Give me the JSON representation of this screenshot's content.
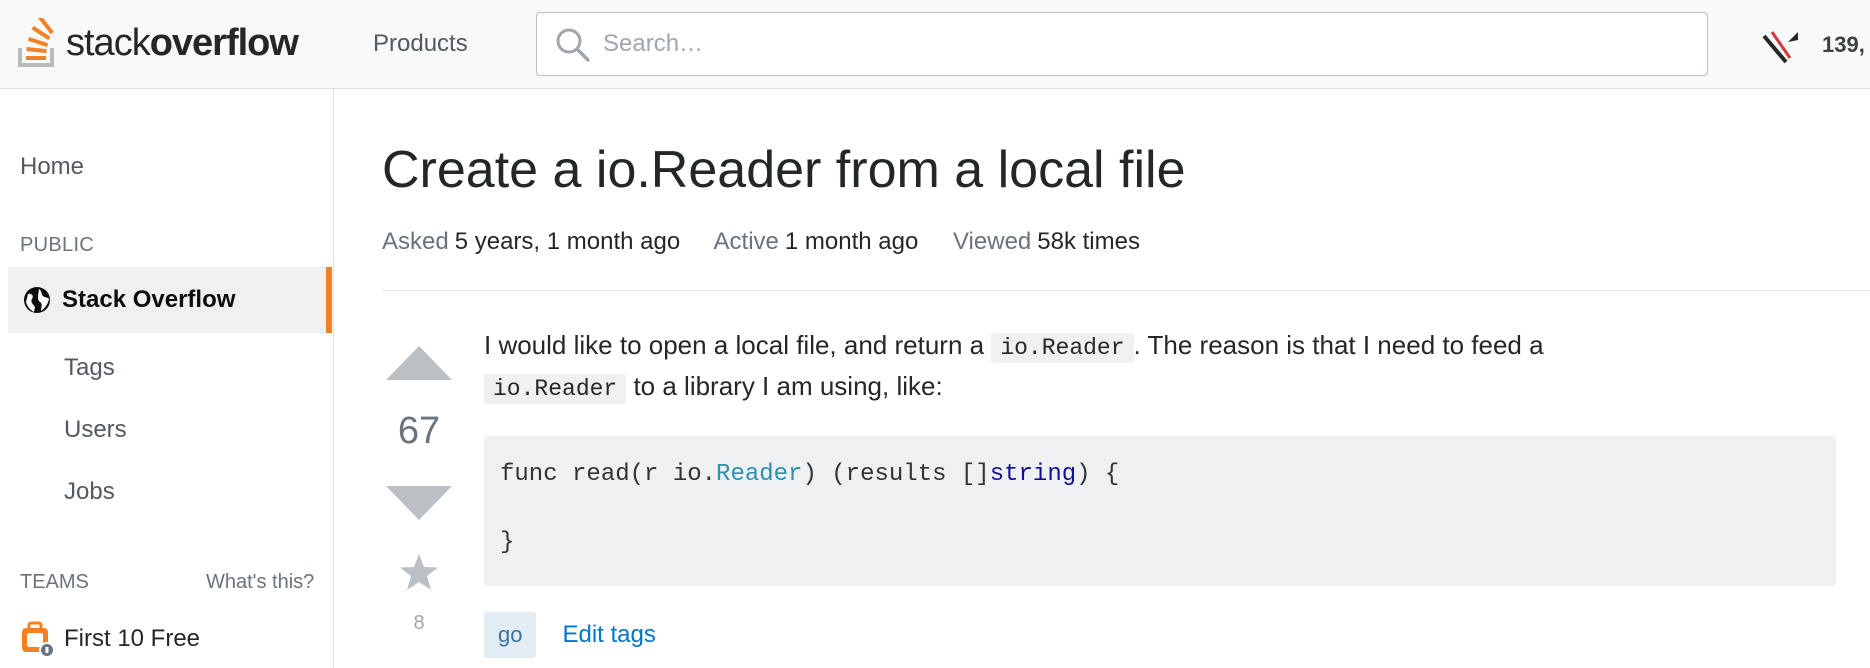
{
  "header": {
    "logo": {
      "brand_light": "stack",
      "brand_bold": "overflow"
    },
    "products_label": "Products",
    "search": {
      "placeholder": "Search…",
      "value": ""
    },
    "reputation": "139,"
  },
  "sidebar": {
    "home": "Home",
    "public_heading": "PUBLIC",
    "stack_overflow": "Stack Overflow",
    "items": [
      "Tags",
      "Users",
      "Jobs"
    ],
    "teams_heading": "TEAMS",
    "whats_this": "What's this?",
    "first_free": "First 10 Free"
  },
  "question": {
    "title": "Create a io.Reader from a local file",
    "meta": {
      "asked_label": "Asked",
      "asked_value": "5 years, 1 month ago",
      "active_label": "Active",
      "active_value": "1 month ago",
      "viewed_label": "Viewed",
      "viewed_value": "58k times"
    },
    "votes": "67",
    "favorites": "8",
    "body": {
      "text_1": "I would like to open a local file, and return a ",
      "code_1": "io.Reader",
      "text_2": ". The reason is that I need to feed a",
      "code_2": "io.Reader",
      "text_3": " to a library I am using, like:"
    },
    "code_block": {
      "line1_a": "func read(r io.",
      "line1_type": "Reader",
      "line1_b": ") (results []",
      "line1_kw": "string",
      "line1_c": ") {",
      "line2": "",
      "line3": "}"
    },
    "tags": [
      "go"
    ],
    "edit_tags": "Edit tags"
  },
  "colors": {
    "accent_orange": "#f48024",
    "link_blue": "#0077cc",
    "tag_bg": "#e1ecf4",
    "tag_text": "#39739d"
  }
}
